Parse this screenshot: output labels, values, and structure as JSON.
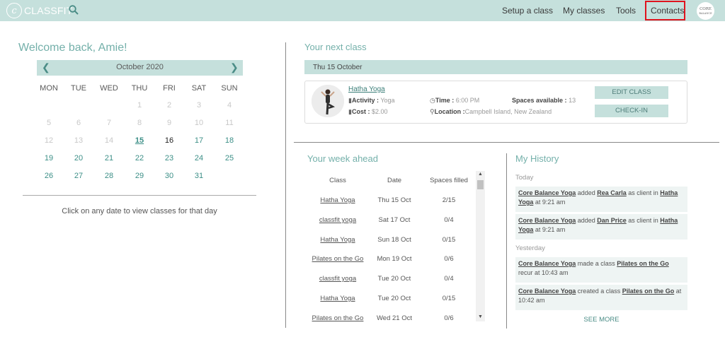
{
  "app": {
    "name": "CLASSFIT"
  },
  "nav": [
    {
      "label": "Setup a class"
    },
    {
      "label": "My classes"
    },
    {
      "label": "Tools"
    },
    {
      "label": "Contacts"
    }
  ],
  "avatar": {
    "line1": "CORE",
    "line2": "BALANCE"
  },
  "welcome": "Welcome back, Amie!",
  "calendar": {
    "month": "October 2020",
    "dow": [
      "MON",
      "TUE",
      "WED",
      "THU",
      "FRI",
      "SAT",
      "SUN"
    ],
    "weeks": [
      [
        {
          "d": "",
          "s": "blank"
        },
        {
          "d": "",
          "s": "blank"
        },
        {
          "d": "",
          "s": "blank"
        },
        {
          "d": "1",
          "s": "muted"
        },
        {
          "d": "2",
          "s": "muted"
        },
        {
          "d": "3",
          "s": "muted"
        },
        {
          "d": "4",
          "s": "muted"
        }
      ],
      [
        {
          "d": "5",
          "s": "muted"
        },
        {
          "d": "6",
          "s": "muted"
        },
        {
          "d": "7",
          "s": "muted"
        },
        {
          "d": "8",
          "s": "muted"
        },
        {
          "d": "9",
          "s": "muted"
        },
        {
          "d": "10",
          "s": "muted"
        },
        {
          "d": "11",
          "s": "muted"
        }
      ],
      [
        {
          "d": "12",
          "s": "muted"
        },
        {
          "d": "13",
          "s": "muted"
        },
        {
          "d": "14",
          "s": "muted"
        },
        {
          "d": "15",
          "s": "today"
        },
        {
          "d": "16",
          "s": "current"
        },
        {
          "d": "17",
          "s": "active"
        },
        {
          "d": "18",
          "s": "active"
        }
      ],
      [
        {
          "d": "19",
          "s": "active"
        },
        {
          "d": "20",
          "s": "active"
        },
        {
          "d": "21",
          "s": "active"
        },
        {
          "d": "22",
          "s": "active"
        },
        {
          "d": "23",
          "s": "active"
        },
        {
          "d": "24",
          "s": "active"
        },
        {
          "d": "25",
          "s": "active"
        }
      ],
      [
        {
          "d": "26",
          "s": "active"
        },
        {
          "d": "27",
          "s": "active"
        },
        {
          "d": "28",
          "s": "active"
        },
        {
          "d": "29",
          "s": "active"
        },
        {
          "d": "30",
          "s": "active"
        },
        {
          "d": "31",
          "s": "active"
        },
        {
          "d": "",
          "s": "blank"
        }
      ]
    ],
    "hint": "Click on any date to view classes for that day"
  },
  "next_class": {
    "title": "Your next class",
    "date": "Thu 15 October",
    "name": "Hatha Yoga",
    "activity_label": "Activity :",
    "activity": "Yoga",
    "cost_label": "Cost :",
    "cost": "$2.00",
    "time_label": "Time :",
    "time": "6:00 PM",
    "location_label": "Location :",
    "location": "Campbell Island, New Zealand",
    "spaces_label": "Spaces available :",
    "spaces": "13",
    "edit_label": "EDIT CLASS",
    "checkin_label": "CHECK-IN"
  },
  "week": {
    "title": "Your week ahead",
    "headers": [
      "Class",
      "Date",
      "Spaces filled"
    ],
    "rows": [
      {
        "class": "Hatha Yoga",
        "date": "Thu 15 Oct",
        "spaces": "2/15"
      },
      {
        "class": "classfit yoga",
        "date": "Sat 17 Oct",
        "spaces": "0/4"
      },
      {
        "class": "Hatha Yoga",
        "date": "Sun 18 Oct",
        "spaces": "0/15"
      },
      {
        "class": "Pilates on the Go",
        "date": "Mon 19 Oct",
        "spaces": "0/6"
      },
      {
        "class": "classfit yoga",
        "date": "Tue 20 Oct",
        "spaces": "0/4"
      },
      {
        "class": "Hatha Yoga",
        "date": "Tue 20 Oct",
        "spaces": "0/15"
      },
      {
        "class": "Pilates on the Go",
        "date": "Wed 21 Oct",
        "spaces": "0/6"
      }
    ]
  },
  "history": {
    "title": "My History",
    "today_label": "Today",
    "yesterday_label": "Yesterday",
    "items": [
      {
        "actor": "Core Balance Yoga",
        "t1": " added ",
        "obj": "Rea Carla",
        "t2": " as client in ",
        "target": "Hatha Yoga",
        "t3": " at 9:21 am"
      },
      {
        "actor": "Core Balance Yoga",
        "t1": " added ",
        "obj": "Dan Price",
        "t2": " as client in ",
        "target": "Hatha Yoga",
        "t3": " at 9:21 am"
      },
      {
        "actor": "Core Balance Yoga",
        "t1": " made a class ",
        "obj": "Pilates on the Go",
        "t2": " recur at 10:43 am",
        "target": "",
        "t3": ""
      },
      {
        "actor": "Core Balance Yoga",
        "t1": " created a class ",
        "obj": "Pilates on the Go",
        "t2": " at 10:42 am",
        "target": "",
        "t3": ""
      }
    ],
    "see_more": "SEE MORE"
  }
}
